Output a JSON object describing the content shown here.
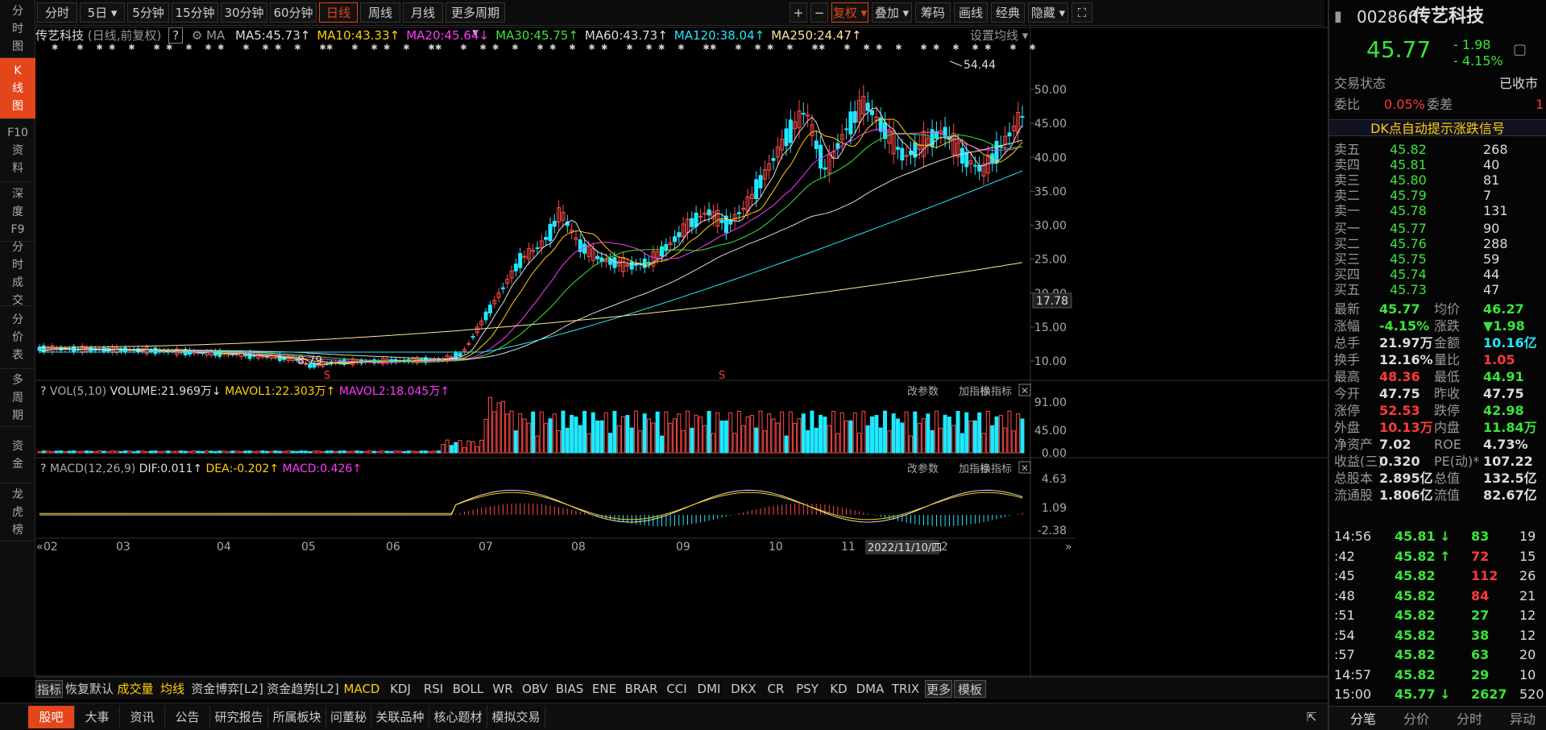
{
  "left_nav": [
    {
      "label": "分\n时\n图",
      "active": false
    },
    {
      "label": "K\n线\n图",
      "active": true
    },
    {
      "label": "F10\n资\n料",
      "active": false
    },
    {
      "label": "深\n度\nF9",
      "active": false
    },
    {
      "label": "分\n时\n成\n交",
      "active": false
    },
    {
      "label": "分\n价\n表",
      "active": false
    },
    {
      "label": "多\n周\n期",
      "active": false
    },
    {
      "label": "资\n金",
      "active": false
    },
    {
      "label": "龙\n虎\n榜",
      "active": false
    }
  ],
  "toolbar": {
    "left": [
      "分时",
      "5日 ▾",
      "5分钟",
      "15分钟",
      "30分钟",
      "60分钟",
      "日线",
      "周线",
      "月线",
      "更多周期 ▾"
    ],
    "right": [
      "+",
      "−",
      "复权 ▾",
      "叠加 ▾",
      "筹码",
      "画线",
      "经典",
      "隐藏 ▾",
      "⛶"
    ]
  },
  "chart": {
    "stock_name": "传艺科技",
    "mode": "(日线,前复权)",
    "q": "?",
    "ma_label": "MA",
    "ma": [
      {
        "text": "MA5:45.73",
        "arrow": "↑",
        "color": "#dddddd"
      },
      {
        "text": "MA10:43.33",
        "arrow": "↑",
        "color": "#ffd200"
      },
      {
        "text": "MA20:45.64",
        "arrow": "↓",
        "color": "#ff3aff"
      },
      {
        "text": "MA30:45.75",
        "arrow": "↑",
        "color": "#39e639"
      },
      {
        "text": "MA60:43.73",
        "arrow": "↑",
        "color": "#dddddd"
      },
      {
        "text": "MA120:38.04",
        "arrow": "↑",
        "color": "#21e8ff"
      },
      {
        "text": "MA250:24.47",
        "arrow": "↑",
        "color": "#ffe69a"
      }
    ],
    "settings": "设置均线 ▾",
    "y_ticks": [
      "50.00",
      "45.00",
      "40.00",
      "35.00",
      "30.00",
      "25.00",
      "20.00",
      "15.00",
      "10.00"
    ],
    "current_price_tag": "17.78",
    "high_label": "54.44",
    "low_label": "8.79",
    "signal_mark": "S",
    "x_ticks": [
      "02",
      "03",
      "04",
      "05",
      "06",
      "07",
      "08",
      "09",
      "10",
      "11",
      "12"
    ],
    "cursor_date": "2022/11/10/四",
    "vol_header": {
      "q": "?",
      "name": "VOL(5,10)",
      "volume": "VOLUME:21.969万",
      "volume_arrow": "↓",
      "mavol1": "MAVOL1:22.303万",
      "mavol1_arrow": "↑",
      "mavol2": "MAVOL2:18.045万",
      "mavol2_arrow": "↑"
    },
    "vol_ticks": [
      "91.00",
      "45.00",
      "0.00"
    ],
    "macd_header": {
      "q": "?",
      "name": "MACD(12,26,9)",
      "dif": "DIF:0.011",
      "dif_arrow": "↑",
      "dea": "DEA:-0.202",
      "dea_arrow": "↑",
      "macd": "MACD:0.426",
      "macd_arrow": "↑"
    },
    "macd_ticks": [
      "4.63",
      "1.09",
      "-2.38"
    ],
    "panel_buttons": [
      "改参数",
      "加指标",
      "换指标",
      "✕"
    ]
  },
  "indicator_bar": [
    "指标",
    "恢复默认",
    "成交量",
    "均线",
    "资金博弈[L2]",
    "资金趋势[L2]",
    "MACD",
    "KDJ",
    "RSI",
    "BOLL",
    "WR",
    "OBV",
    "BIAS",
    "ENE",
    "BRAR",
    "CCI",
    "DMI",
    "DKX",
    "CR",
    "PSY",
    "KD",
    "DMA",
    "TRIX",
    "更多",
    "模板"
  ],
  "bottom_tabs": [
    "股吧",
    "大事",
    "资讯",
    "公告",
    "研究报告",
    "所属板块",
    "问董秘",
    "关联品种",
    "核心题材",
    "模拟交易"
  ],
  "quote": {
    "code": "002866",
    "name": "传艺科技",
    "price": "45.77",
    "change": "- 1.98",
    "change_pct": "- 4.15%",
    "status_label": "交易状态",
    "status_value": "已收市",
    "wb_label": "委比",
    "wb_value": "0.05%",
    "wc_label": "委差",
    "wc_value": "1",
    "signal_banner": "DK点自动提示涨跌信号",
    "asks": [
      {
        "label": "卖五",
        "price": "45.82",
        "vol": "268"
      },
      {
        "label": "卖四",
        "price": "45.81",
        "vol": "40"
      },
      {
        "label": "卖三",
        "price": "45.80",
        "vol": "81"
      },
      {
        "label": "卖二",
        "price": "45.79",
        "vol": "7"
      },
      {
        "label": "卖一",
        "price": "45.78",
        "vol": "131"
      }
    ],
    "bids": [
      {
        "label": "买一",
        "price": "45.77",
        "vol": "90"
      },
      {
        "label": "买二",
        "price": "45.76",
        "vol": "288"
      },
      {
        "label": "买三",
        "price": "45.75",
        "vol": "59"
      },
      {
        "label": "买四",
        "price": "45.74",
        "vol": "44"
      },
      {
        "label": "买五",
        "price": "45.73",
        "vol": "47"
      }
    ],
    "stats": [
      {
        "l1": "最新",
        "v1": "45.77",
        "c1": "green",
        "l2": "均价",
        "v2": "46.27",
        "c2": "green"
      },
      {
        "l1": "涨幅",
        "v1": "-4.15%",
        "c1": "green",
        "l2": "涨跌",
        "v2": "▼1.98",
        "c2": "green"
      },
      {
        "l1": "总手",
        "v1": "21.97万",
        "c1": "white",
        "l2": "金额",
        "v2": "10.16亿",
        "c2": "cyan"
      },
      {
        "l1": "换手",
        "v1": "12.16%",
        "c1": "white",
        "l2": "量比",
        "v2": "1.05",
        "c2": "red"
      },
      {
        "l1": "最高",
        "v1": "48.36",
        "c1": "red",
        "l2": "最低",
        "v2": "44.91",
        "c2": "green"
      },
      {
        "l1": "今开",
        "v1": "47.75",
        "c1": "white",
        "l2": "昨收",
        "v2": "47.75",
        "c2": "white"
      },
      {
        "l1": "涨停",
        "v1": "52.53",
        "c1": "red",
        "l2": "跌停",
        "v2": "42.98",
        "c2": "green"
      },
      {
        "l1": "外盘",
        "v1": "10.13万",
        "c1": "red",
        "l2": "内盘",
        "v2": "11.84万",
        "c2": "green"
      },
      {
        "l1": "净资产",
        "v1": "7.02",
        "c1": "white",
        "l2": "ROE",
        "v2": "4.73%",
        "c2": "white"
      },
      {
        "l1": "收益(三)",
        "v1": "0.320",
        "c1": "white",
        "l2": "PE(动)*",
        "v2": "107.22",
        "c2": "white"
      },
      {
        "l1": "总股本",
        "v1": "2.895亿",
        "c1": "white",
        "l2": "总值",
        "v2": "132.5亿",
        "c2": "white"
      },
      {
        "l1": "流通股",
        "v1": "1.806亿",
        "c1": "white",
        "l2": "流值",
        "v2": "82.67亿",
        "c2": "white"
      }
    ],
    "ticks": [
      {
        "time": "14:56",
        "price": "45.81",
        "arrow": "↓",
        "vol": "83",
        "vc": "green",
        "n": "19"
      },
      {
        "time": ":42",
        "price": "45.82",
        "arrow": "↑",
        "vol": "72",
        "vc": "red",
        "n": "15"
      },
      {
        "time": ":45",
        "price": "45.82",
        "arrow": "",
        "vol": "112",
        "vc": "red",
        "n": "26"
      },
      {
        "time": ":48",
        "price": "45.82",
        "arrow": "",
        "vol": "84",
        "vc": "red",
        "n": "21"
      },
      {
        "time": ":51",
        "price": "45.82",
        "arrow": "",
        "vol": "27",
        "vc": "green",
        "n": "12"
      },
      {
        "time": ":54",
        "price": "45.82",
        "arrow": "",
        "vol": "38",
        "vc": "green",
        "n": "12"
      },
      {
        "time": ":57",
        "price": "45.82",
        "arrow": "",
        "vol": "63",
        "vc": "green",
        "n": "20"
      },
      {
        "time": "14:57",
        "price": "45.82",
        "arrow": "",
        "vol": "29",
        "vc": "green",
        "n": "10"
      },
      {
        "time": "15:00",
        "price": "45.77",
        "arrow": "↓",
        "vol": "2627",
        "vc": "green",
        "n": "520"
      }
    ],
    "bottom_tabs": [
      "分笔",
      "分价",
      "分时",
      "异动"
    ]
  }
}
